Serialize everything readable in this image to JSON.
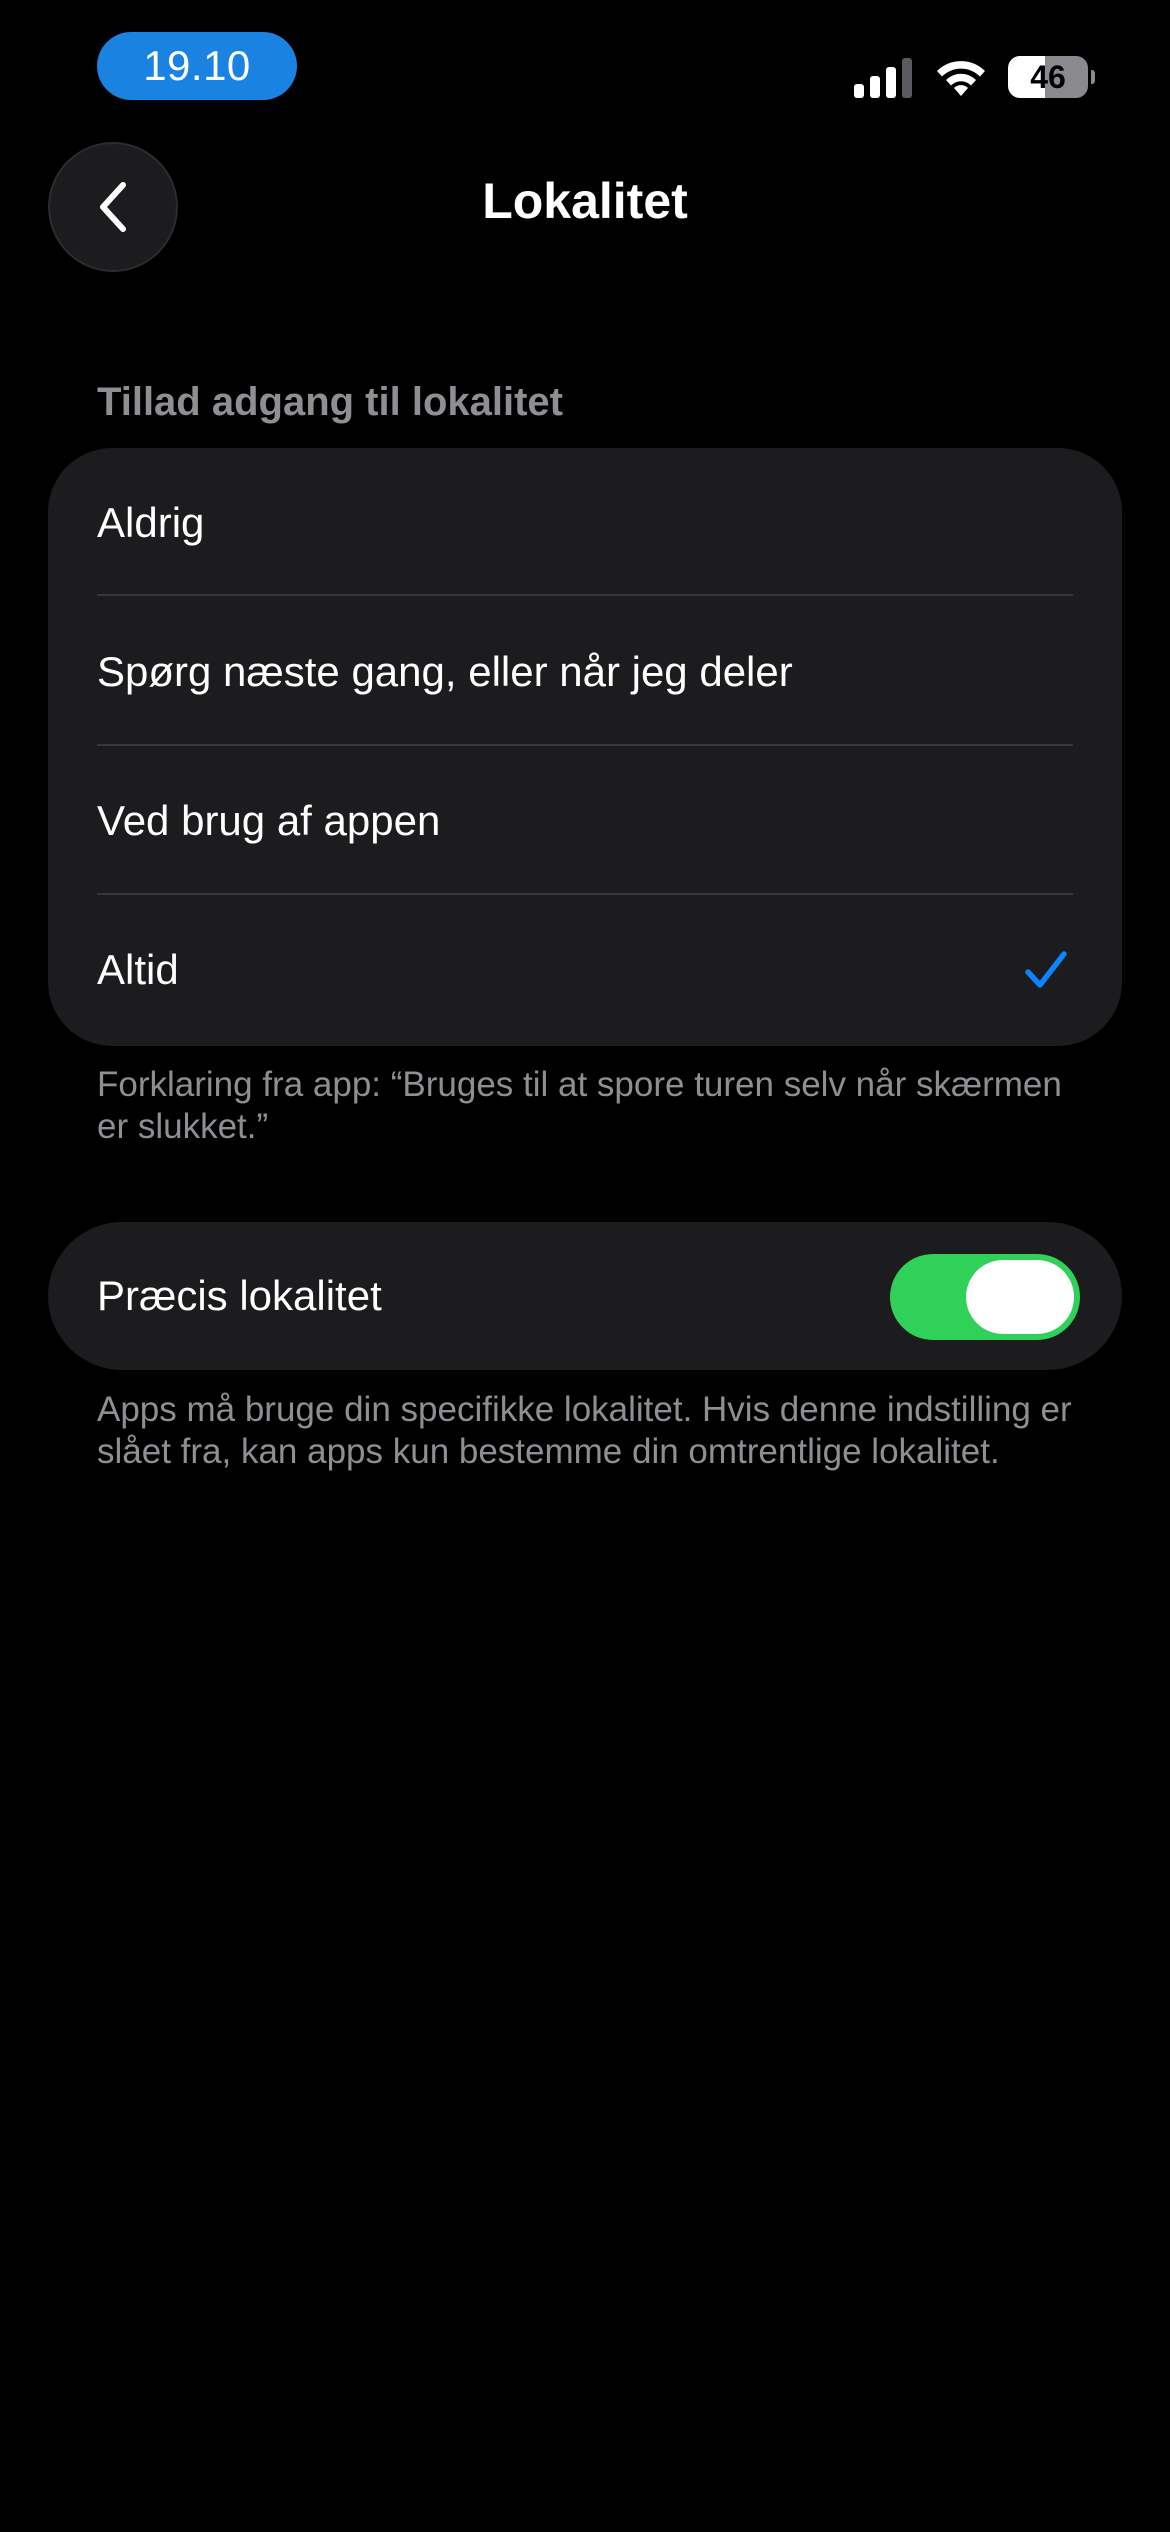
{
  "status_bar": {
    "time": "19.10",
    "battery_percent": "46",
    "battery_level": 0.46,
    "signal_icon": "cellular-signal-icon",
    "wifi_icon": "wifi-icon"
  },
  "nav": {
    "title": "Lokalitet",
    "back_icon": "chevron-left-icon"
  },
  "access_section": {
    "header": "Tillad adgang til lokalitet",
    "options": [
      {
        "label": "Aldrig",
        "selected": false
      },
      {
        "label": "Spørg næste gang, eller når jeg deler",
        "selected": false
      },
      {
        "label": "Ved brug af appen",
        "selected": false
      },
      {
        "label": "Altid",
        "selected": true
      }
    ],
    "footnote": "Forklaring fra app: “Bruges til at spore turen selv når skærmen er slukket.”"
  },
  "precise_section": {
    "label": "Præcis lokalitet",
    "enabled": true,
    "footnote": "Apps må bruge din specifikke lokalitet. Hvis denne indstilling er slået fra, kan apps kun bestemme din omtrentlige lokalitet."
  },
  "colors": {
    "accent_blue": "#0a84ff",
    "toggle_on": "#30d158",
    "time_pill": "#1a82e0",
    "group_background": "#1c1c1e",
    "secondary_text": "#8e8e93"
  }
}
